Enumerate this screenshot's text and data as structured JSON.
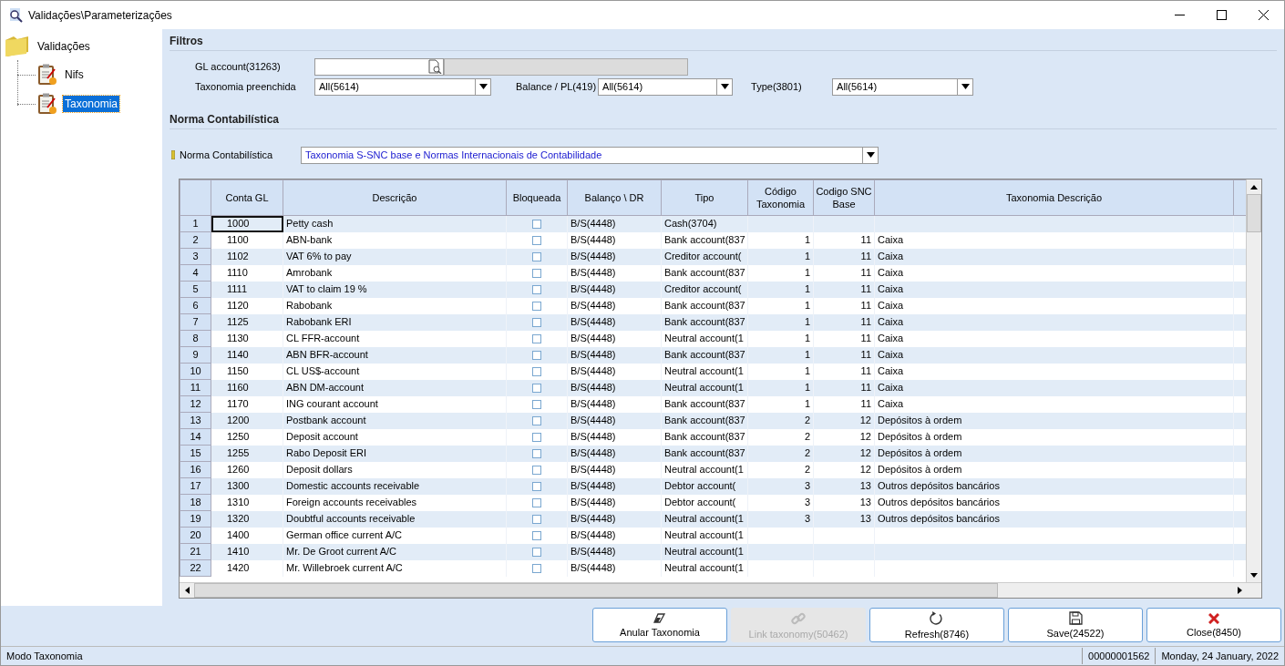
{
  "window": {
    "title": "Validações\\Parameterizações"
  },
  "tree": {
    "label": "Validações",
    "children": [
      {
        "label": "Nifs",
        "selected": false
      },
      {
        "label": "Taxonomia",
        "selected": true
      }
    ]
  },
  "filters": {
    "title": "Filtros",
    "gl_account": {
      "label": "GL account(31263)"
    },
    "selects": [
      {
        "label": "Taxonomia preenchida",
        "value": "All(5614)"
      },
      {
        "label": "Balance / PL(419)",
        "value": "All(5614)"
      },
      {
        "label": "Type(3801)",
        "value": "All(5614)"
      }
    ]
  },
  "norma": {
    "title": "Norma Contabilística",
    "label": "Norma Contabilística",
    "value": "Taxonomia S-SNC base e Normas Internacionais de Contabilidade"
  },
  "table": {
    "columns": [
      "Conta GL",
      "Descrição",
      "Bloqueada",
      "Balanço \\ DR",
      "Tipo",
      "Código Taxonomia",
      "Codigo SNC Base",
      "Taxonomia Descrição"
    ],
    "rows": [
      {
        "n": "1",
        "conta": "1000",
        "descricao": "Petty cash",
        "blocked": false,
        "balanco": "B/S(4448)",
        "tipo": "Cash(3704)",
        "codigo": "",
        "snc": "",
        "taxonomia": "",
        "selected": true
      },
      {
        "n": "2",
        "conta": "1100",
        "descricao": "ABN-bank",
        "blocked": false,
        "balanco": "B/S(4448)",
        "tipo": "Bank account(837",
        "codigo": "1",
        "snc": "11",
        "taxonomia": "Caixa",
        "selected": false
      },
      {
        "n": "3",
        "conta": "1102",
        "descricao": "VAT  6% to pay",
        "blocked": false,
        "balanco": "B/S(4448)",
        "tipo": "Creditor account(",
        "codigo": "1",
        "snc": "11",
        "taxonomia": "Caixa",
        "selected": false
      },
      {
        "n": "4",
        "conta": "1110",
        "descricao": "Amrobank",
        "blocked": false,
        "balanco": "B/S(4448)",
        "tipo": "Bank account(837",
        "codigo": "1",
        "snc": "11",
        "taxonomia": "Caixa",
        "selected": false
      },
      {
        "n": "5",
        "conta": "1111",
        "descricao": "VAT to claim 19 %",
        "blocked": false,
        "balanco": "B/S(4448)",
        "tipo": "Creditor account(",
        "codigo": "1",
        "snc": "11",
        "taxonomia": "Caixa",
        "selected": false
      },
      {
        "n": "6",
        "conta": "1120",
        "descricao": "Rabobank",
        "blocked": false,
        "balanco": "B/S(4448)",
        "tipo": "Bank account(837",
        "codigo": "1",
        "snc": "11",
        "taxonomia": "Caixa",
        "selected": false
      },
      {
        "n": "7",
        "conta": "1125",
        "descricao": "Rabobank ERI",
        "blocked": false,
        "balanco": "B/S(4448)",
        "tipo": "Bank account(837",
        "codigo": "1",
        "snc": "11",
        "taxonomia": "Caixa",
        "selected": false
      },
      {
        "n": "8",
        "conta": "1130",
        "descricao": "CL FFR-account",
        "blocked": false,
        "balanco": "B/S(4448)",
        "tipo": "Neutral account(1",
        "codigo": "1",
        "snc": "11",
        "taxonomia": "Caixa",
        "selected": false
      },
      {
        "n": "9",
        "conta": "1140",
        "descricao": "ABN BFR-account",
        "blocked": false,
        "balanco": "B/S(4448)",
        "tipo": "Bank account(837",
        "codigo": "1",
        "snc": "11",
        "taxonomia": "Caixa",
        "selected": false
      },
      {
        "n": "10",
        "conta": "1150",
        "descricao": "CL US$-account",
        "blocked": false,
        "balanco": "B/S(4448)",
        "tipo": "Neutral account(1",
        "codigo": "1",
        "snc": "11",
        "taxonomia": "Caixa",
        "selected": false
      },
      {
        "n": "11",
        "conta": "1160",
        "descricao": "ABN DM-account",
        "blocked": false,
        "balanco": "B/S(4448)",
        "tipo": "Neutral account(1",
        "codigo": "1",
        "snc": "11",
        "taxonomia": "Caixa",
        "selected": false
      },
      {
        "n": "12",
        "conta": "1170",
        "descricao": "ING courant account",
        "blocked": false,
        "balanco": "B/S(4448)",
        "tipo": "Bank account(837",
        "codigo": "1",
        "snc": "11",
        "taxonomia": "Caixa",
        "selected": false
      },
      {
        "n": "13",
        "conta": "1200",
        "descricao": "Postbank account",
        "blocked": false,
        "balanco": "B/S(4448)",
        "tipo": "Bank account(837",
        "codigo": "2",
        "snc": "12",
        "taxonomia": "Depósitos à ordem",
        "selected": false
      },
      {
        "n": "14",
        "conta": "1250",
        "descricao": "Deposit account",
        "blocked": false,
        "balanco": "B/S(4448)",
        "tipo": "Bank account(837",
        "codigo": "2",
        "snc": "12",
        "taxonomia": "Depósitos à ordem",
        "selected": false
      },
      {
        "n": "15",
        "conta": "1255",
        "descricao": "Rabo Deposit ERI",
        "blocked": false,
        "balanco": "B/S(4448)",
        "tipo": "Bank account(837",
        "codigo": "2",
        "snc": "12",
        "taxonomia": "Depósitos à ordem",
        "selected": false
      },
      {
        "n": "16",
        "conta": "1260",
        "descricao": "Deposit dollars",
        "blocked": false,
        "balanco": "B/S(4448)",
        "tipo": "Neutral account(1",
        "codigo": "2",
        "snc": "12",
        "taxonomia": "Depósitos à ordem",
        "selected": false
      },
      {
        "n": "17",
        "conta": "1300",
        "descricao": "Domestic accounts receivable",
        "blocked": false,
        "balanco": "B/S(4448)",
        "tipo": "Debtor account(",
        "codigo": "3",
        "snc": "13",
        "taxonomia": "Outros depósitos bancários",
        "selected": false
      },
      {
        "n": "18",
        "conta": "1310",
        "descricao": "Foreign accounts receivables",
        "blocked": false,
        "balanco": "B/S(4448)",
        "tipo": "Debtor account(",
        "codigo": "3",
        "snc": "13",
        "taxonomia": "Outros depósitos bancários",
        "selected": false
      },
      {
        "n": "19",
        "conta": "1320",
        "descricao": "Doubtful accounts receivable",
        "blocked": false,
        "balanco": "B/S(4448)",
        "tipo": "Neutral account(1",
        "codigo": "3",
        "snc": "13",
        "taxonomia": "Outros depósitos bancários",
        "selected": false
      },
      {
        "n": "20",
        "conta": "1400",
        "descricao": "German office current A/C",
        "blocked": false,
        "balanco": "B/S(4448)",
        "tipo": "Neutral account(1",
        "codigo": "",
        "snc": "",
        "taxonomia": "",
        "selected": false
      },
      {
        "n": "21",
        "conta": "1410",
        "descricao": "Mr. De Groot current A/C",
        "blocked": false,
        "balanco": "B/S(4448)",
        "tipo": "Neutral account(1",
        "codigo": "",
        "snc": "",
        "taxonomia": "",
        "selected": false
      },
      {
        "n": "22",
        "conta": "1420",
        "descricao": "Mr. Willebroek current A/C",
        "blocked": false,
        "balanco": "B/S(4448)",
        "tipo": "Neutral account(1",
        "codigo": "",
        "snc": "",
        "taxonomia": "",
        "selected": false
      }
    ]
  },
  "buttons": [
    {
      "kind": "eraser",
      "label": "Anular Taxonomia",
      "disabled": false
    },
    {
      "kind": "link",
      "label": "Link taxonomy(50462)",
      "disabled": true
    },
    {
      "kind": "refresh",
      "label": "Refresh(8746)",
      "disabled": false
    },
    {
      "kind": "save",
      "label": "Save(24522)",
      "disabled": false
    },
    {
      "kind": "close",
      "label": "Close(8450)",
      "disabled": false
    }
  ],
  "status_bar": {
    "mode": "Modo Taxonomia",
    "count": "00000001562",
    "date": "Monday, 24 January, 2022"
  }
}
